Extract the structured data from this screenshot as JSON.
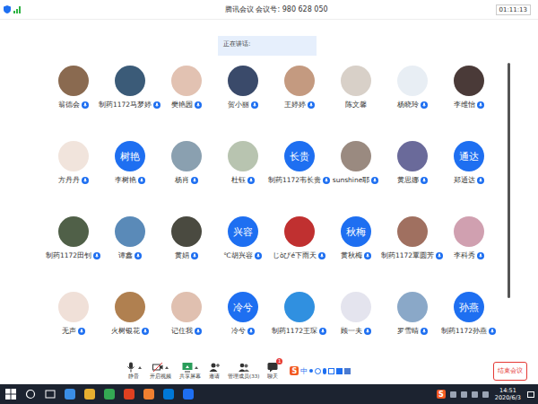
{
  "window": {
    "title": "腾讯会议 会议号: 980 628 050",
    "timer": "01:11:13"
  },
  "speaking": {
    "label": "正在讲话:"
  },
  "participants": [
    {
      "name": "翁德会",
      "mic": true,
      "avatar": {
        "kind": "photo",
        "color": "#8a6a50"
      }
    },
    {
      "name": "制药1172马梦婷",
      "mic": true,
      "avatar": {
        "kind": "photo",
        "color": "#3b5b78"
      }
    },
    {
      "name": "樊艳园",
      "mic": true,
      "avatar": {
        "kind": "photo",
        "color": "#e2c2b2"
      }
    },
    {
      "name": "贺小丽",
      "mic": true,
      "avatar": {
        "kind": "photo",
        "color": "#3a4a6a"
      }
    },
    {
      "name": "王婷婷",
      "mic": true,
      "avatar": {
        "kind": "photo",
        "color": "#c49a80"
      }
    },
    {
      "name": "陈文馨",
      "mic": false,
      "avatar": {
        "kind": "photo",
        "color": "#d8d0c8"
      }
    },
    {
      "name": "杨晓玲",
      "mic": true,
      "avatar": {
        "kind": "photo",
        "color": "#e8eef4"
      }
    },
    {
      "name": "李维怡",
      "mic": true,
      "avatar": {
        "kind": "photo",
        "color": "#4a3a38"
      }
    },
    {
      "name": "方丹丹",
      "mic": true,
      "avatar": {
        "kind": "photo",
        "color": "#f1e4dc"
      }
    },
    {
      "name": "李树艳",
      "mic": true,
      "avatar": {
        "kind": "text",
        "text": "树艳"
      }
    },
    {
      "name": "杨肖",
      "mic": true,
      "avatar": {
        "kind": "photo",
        "color": "#8aa0b0"
      }
    },
    {
      "name": "杜钰",
      "mic": true,
      "avatar": {
        "kind": "photo",
        "color": "#b8c4b0"
      }
    },
    {
      "name": "制药1172韦长贵",
      "mic": true,
      "avatar": {
        "kind": "text",
        "text": "长贵"
      }
    },
    {
      "name": "sunshine耶",
      "mic": true,
      "avatar": {
        "kind": "photo",
        "color": "#9a8a80"
      }
    },
    {
      "name": "黄思娜",
      "mic": true,
      "avatar": {
        "kind": "photo",
        "color": "#6a6a9a"
      }
    },
    {
      "name": "郑通达",
      "mic": true,
      "avatar": {
        "kind": "text",
        "text": "通达"
      }
    },
    {
      "name": "制药1172田钊",
      "mic": true,
      "avatar": {
        "kind": "photo",
        "color": "#506048"
      }
    },
    {
      "name": "谭鑫",
      "mic": true,
      "avatar": {
        "kind": "photo",
        "color": "#5a8ab8"
      }
    },
    {
      "name": "黄娟",
      "mic": true,
      "avatar": {
        "kind": "photo",
        "color": "#4a4a40"
      }
    },
    {
      "name": "℃胡兴容",
      "mic": true,
      "avatar": {
        "kind": "text",
        "text": "兴容"
      }
    },
    {
      "name": "じòぴé下雨天",
      "mic": true,
      "avatar": {
        "kind": "photo",
        "color": "#c03030"
      }
    },
    {
      "name": "黄秋梅",
      "mic": true,
      "avatar": {
        "kind": "text",
        "text": "秋梅"
      }
    },
    {
      "name": "制药1172覃圆芳",
      "mic": true,
      "avatar": {
        "kind": "photo",
        "color": "#a07060"
      }
    },
    {
      "name": "李科秀",
      "mic": true,
      "avatar": {
        "kind": "photo",
        "color": "#d0a0b0"
      }
    },
    {
      "name": "无声",
      "mic": true,
      "avatar": {
        "kind": "photo",
        "color": "#f0e0d8"
      }
    },
    {
      "name": "火树银花",
      "mic": true,
      "avatar": {
        "kind": "photo",
        "color": "#b08050"
      }
    },
    {
      "name": "记住我",
      "mic": true,
      "avatar": {
        "kind": "photo",
        "color": "#e0c0b0"
      }
    },
    {
      "name": "冷兮",
      "mic": true,
      "avatar": {
        "kind": "text",
        "text": "冷兮"
      }
    },
    {
      "name": "制药1172王琛",
      "mic": true,
      "avatar": {
        "kind": "photo",
        "color": "#3090e0"
      }
    },
    {
      "name": "顾一夫",
      "mic": true,
      "avatar": {
        "kind": "photo",
        "color": "#e4e4ee"
      }
    },
    {
      "name": "罗雪晴",
      "mic": true,
      "avatar": {
        "kind": "photo",
        "color": "#8aa8c8"
      }
    },
    {
      "name": "制药1172孙燕",
      "mic": true,
      "avatar": {
        "kind": "text",
        "text": "孙燕"
      }
    }
  ],
  "toolbar": [
    {
      "label": "静音",
      "kind": "mic",
      "caret": true
    },
    {
      "label": "开启视频",
      "kind": "video",
      "caret": true
    },
    {
      "label": "共享屏幕",
      "kind": "share",
      "caret": true
    },
    {
      "label": "邀请",
      "kind": "invite",
      "caret": false
    },
    {
      "label": "管理成员(33)",
      "kind": "members",
      "caret": false
    },
    {
      "label": "聊天",
      "kind": "chat",
      "caret": false,
      "badge": "1"
    }
  ],
  "ime": {
    "logo": "S",
    "mode": "中"
  },
  "end_button": "结束会议",
  "taskbar": {
    "time": "14:51",
    "date": "2020/6/3"
  }
}
